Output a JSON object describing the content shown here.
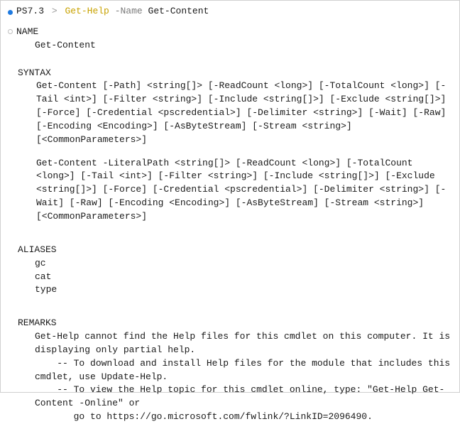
{
  "prompt": {
    "ps_version": "PS7.3",
    "separator": ">",
    "command": "Get-Help",
    "flag": "-Name",
    "argument": "Get-Content"
  },
  "output": {
    "name_label": "NAME",
    "name_value": "Get-Content",
    "syntax_label": "SYNTAX",
    "syntax_block1": "Get-Content [-Path] <string[]> [-ReadCount <long>] [-TotalCount <long>] [-Tail <int>] [-Filter <string>] [-Include <string[]>] [-Exclude <string[]>] [-Force] [-Credential <pscredential>] [-Delimiter <string>] [-Wait] [-Raw] [-Encoding <Encoding>] [-AsByteStream] [-Stream <string>] [<CommonParameters>]",
    "syntax_block2": "Get-Content -LiteralPath <string[]> [-ReadCount <long>] [-TotalCount <long>] [-Tail <int>] [-Filter <string>] [-Include <string[]>] [-Exclude <string[]>] [-Force] [-Credential <pscredential>] [-Delimiter <string>] [-Wait] [-Raw] [-Encoding <Encoding>] [-AsByteStream] [-Stream <string>] [<CommonParameters>]",
    "aliases_label": "ALIASES",
    "aliases": [
      "gc",
      "cat",
      "type"
    ],
    "remarks_label": "REMARKS",
    "remarks_text": "Get-Help cannot find the Help files for this cmdlet on this computer. It is displaying only partial help.\n    -- To download and install Help files for the module that includes this cmdlet, use Update-Help.\n    -- To view the Help topic for this cmdlet online, type: \"Get-Help Get-Content -Online\" or\n       go to https://go.microsoft.com/fwlink/?LinkID=2096490."
  }
}
